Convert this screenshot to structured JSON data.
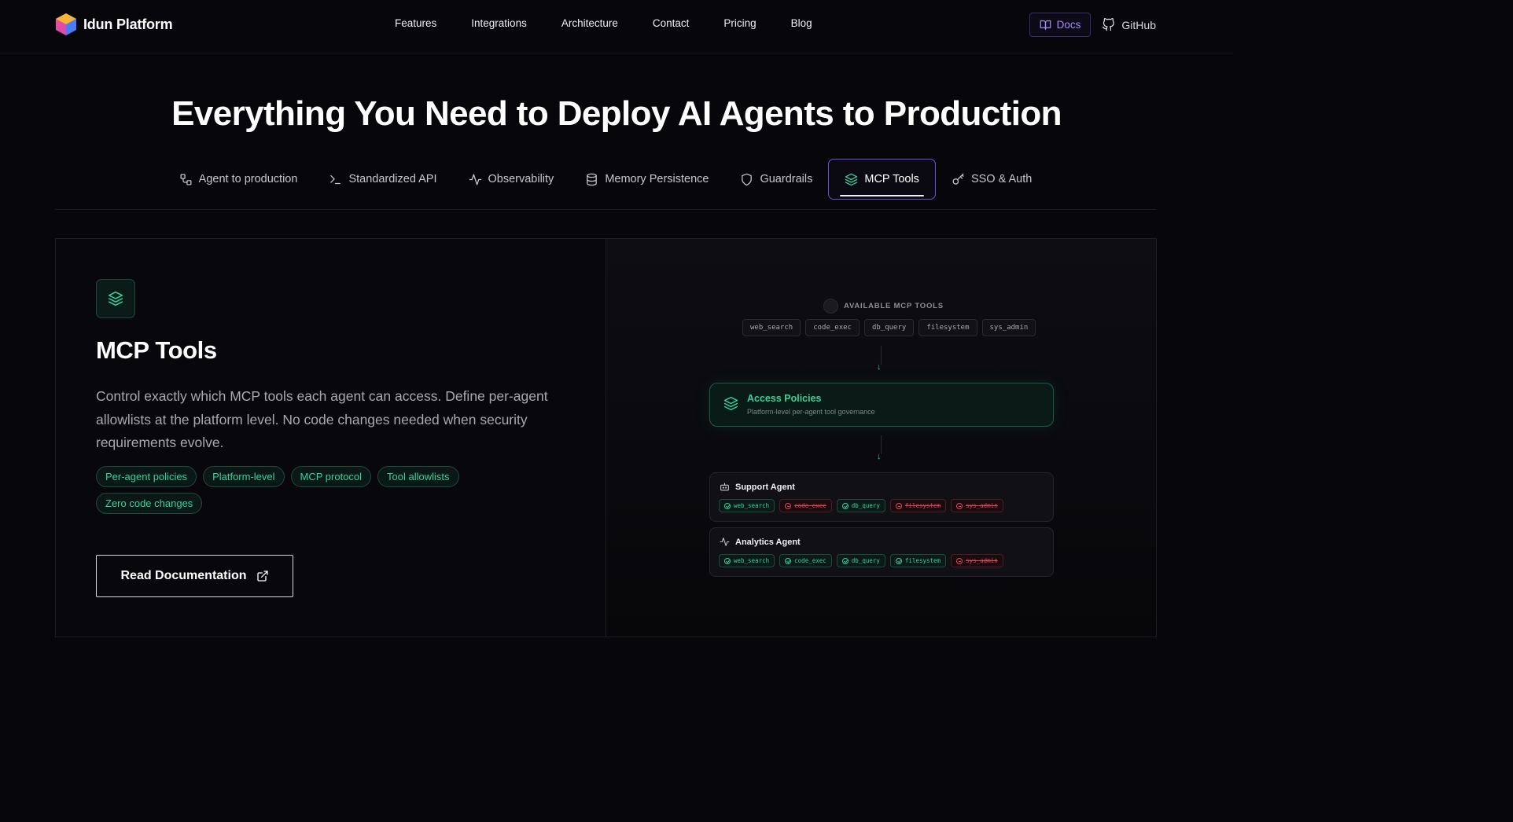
{
  "nav": {
    "brand": "Idun Platform",
    "links": [
      "Features",
      "Integrations",
      "Architecture",
      "Contact",
      "Pricing",
      "Blog"
    ],
    "docs_label": "Docs",
    "github_label": "GitHub"
  },
  "hero": {
    "title": "Everything You Need to Deploy AI Agents to Production"
  },
  "tabs": [
    {
      "label": "Agent to production",
      "icon": "workflow-icon"
    },
    {
      "label": "Standardized API",
      "icon": "terminal-icon"
    },
    {
      "label": "Observability",
      "icon": "activity-icon"
    },
    {
      "label": "Memory Persistence",
      "icon": "database-icon"
    },
    {
      "label": "Guardrails",
      "icon": "shield-icon"
    },
    {
      "label": "MCP Tools",
      "icon": "layers-icon",
      "active": true
    },
    {
      "label": "SSO & Auth",
      "icon": "key-icon"
    }
  ],
  "feature": {
    "title": "MCP Tools",
    "description": "Control exactly which MCP tools each agent can access. Define per-agent allowlists at the platform level. No code changes needed when security requirements evolve.",
    "tags": [
      "Per-agent policies",
      "Platform-level",
      "MCP protocol",
      "Tool allowlists",
      "Zero code changes"
    ],
    "cta_label": "Read Documentation"
  },
  "diagram": {
    "available_label": "AVAILABLE MCP TOOLS",
    "available_tools": [
      "web_search",
      "code_exec",
      "db_query",
      "filesystem",
      "sys_admin"
    ],
    "policy_title": "Access Policies",
    "policy_subtitle": "Platform-level per-agent tool governance",
    "agents": [
      {
        "name": "Support Agent",
        "icon": "bot-icon",
        "tools": [
          {
            "name": "web_search",
            "allowed": true
          },
          {
            "name": "code_exec",
            "allowed": false
          },
          {
            "name": "db_query",
            "allowed": true
          },
          {
            "name": "filesystem",
            "allowed": false
          },
          {
            "name": "sys_admin",
            "allowed": false
          }
        ]
      },
      {
        "name": "Analytics Agent",
        "icon": "activity-icon",
        "tools": [
          {
            "name": "web_search",
            "allowed": true
          },
          {
            "name": "code_exec",
            "allowed": true
          },
          {
            "name": "db_query",
            "allowed": true
          },
          {
            "name": "filesystem",
            "allowed": true
          },
          {
            "name": "sys_admin",
            "allowed": false
          }
        ]
      }
    ]
  },
  "colors": {
    "accent_green": "#34d399",
    "accent_purple": "#a78bfa",
    "deny_red": "#e0455e",
    "background": "#07070b"
  }
}
